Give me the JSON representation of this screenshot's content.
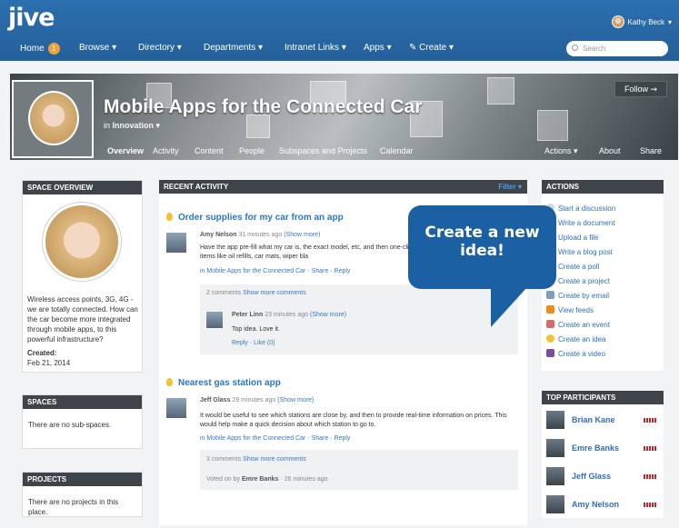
{
  "topbar": {
    "logo": "jive",
    "user_name": "Kathy Beck",
    "nav": {
      "home": "Home",
      "home_badge": "1",
      "browse": "Browse",
      "directory": "Directory",
      "departments": "Departments",
      "intranet_links": "Intranet Links",
      "apps": "Apps",
      "create": "Create"
    },
    "search_placeholder": "Search"
  },
  "space": {
    "title": "Mobile Apps for the Connected Car",
    "in_label": "in",
    "parent": "Innovation",
    "follow": "Follow",
    "tabs": {
      "overview": "Overview",
      "activity": "Activity",
      "content": "Content",
      "people": "People",
      "subspaces": "Subspaces and Projects",
      "calendar": "Calendar",
      "actions": "Actions",
      "about": "About",
      "share": "Share"
    }
  },
  "overview": {
    "heading": "SPACE OVERVIEW",
    "description": "Wireless access points, 3G, 4G - we are totally connected. How can the car become more integrated through mobile apps, to this powerful infrastructure?",
    "created_label": "Created:",
    "created_date": "Feb 21, 2014"
  },
  "spaces": {
    "heading": "SPACES",
    "text": "There are no sub-spaces."
  },
  "projects": {
    "heading": "PROJECTS",
    "text": "There are no projects in this place."
  },
  "activity": {
    "heading": "RECENT ACTIVITY",
    "filter": "Filter",
    "items": [
      {
        "title": "Order supplies for my car from an app",
        "author": "Amy Nelson",
        "time": "31 minutes ago",
        "show_more": "(Show more)",
        "body": "Have the app pre-fill what my car is, the exact model, etc, and then one-click. I'm thinking about items like oil refills, car mats, wiper bla",
        "location": "in Mobile Apps for the Connected Car",
        "share": "Share",
        "reply": "Reply",
        "comments": "2 comments",
        "show_more_comments": "Show more comments",
        "comment_author": "Peter Linn",
        "comment_time": "23 minutes ago",
        "comment_show_more": "(Show more)",
        "comment_body": "Top idea. Love it.",
        "comment_reply": "Reply",
        "comment_like": "Like (0)"
      },
      {
        "title": "Nearest gas station app",
        "author": "Jeff Glass",
        "time": "29 minutes ago",
        "show_more": "(Show more)",
        "body": "It would be useful to see which stations are close by, and then to provide real-time information on prices. This would help make a quick decision about which station to go to.",
        "location": "in Mobile Apps for the Connected Car",
        "share": "Share",
        "reply": "Reply",
        "comments": "3 comments",
        "show_more_comments": "Show more comments",
        "voted_prefix": "Voted on by",
        "voted_by": "Emre Banks",
        "voted_time": "26 minutes ago"
      }
    ]
  },
  "actions": {
    "heading": "ACTIONS",
    "items": [
      "Start a discussion",
      "Write a document",
      "Upload a file",
      "Write a blog post",
      "Create a poll",
      "Create a project",
      "Create by email",
      "View feeds",
      "Create an event",
      "Create an idea",
      "Create a video"
    ]
  },
  "participants": {
    "heading": "TOP PARTICIPANTS",
    "items": [
      "Brian Kane",
      "Emre Banks",
      "Jeff Glass",
      "Amy Nelson"
    ]
  },
  "callout": {
    "line1": "Create a new",
    "line2": "idea!"
  },
  "colors": {
    "brand": "#2c6fae",
    "callout": "#1a60a2",
    "panel_head": "#3e4449",
    "link": "#3778c7"
  }
}
